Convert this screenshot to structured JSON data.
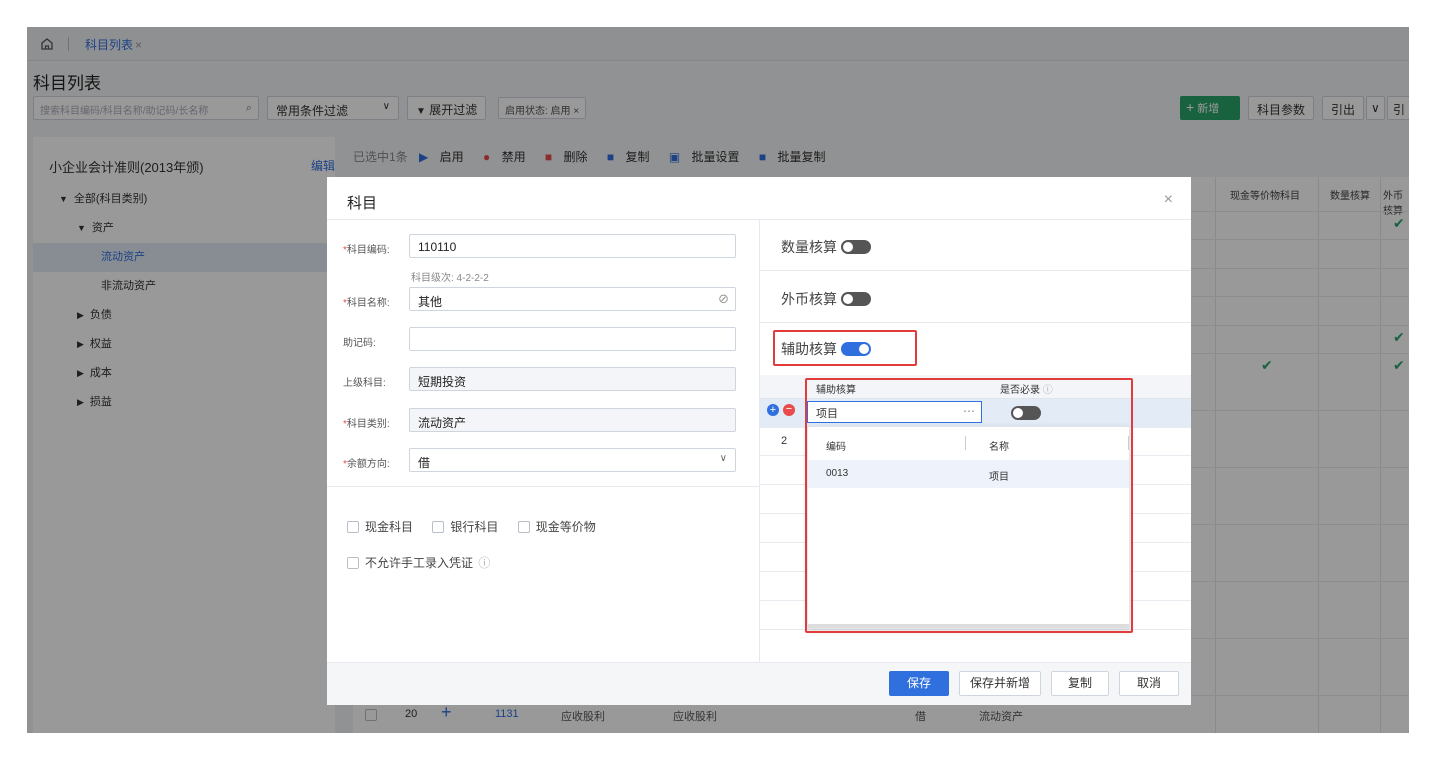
{
  "tabbar": {
    "home_icon": "home-icon",
    "tab_label": "科目列表",
    "tab_close": "×"
  },
  "page": {
    "title": "科目列表"
  },
  "toolbar": {
    "search_placeholder": "搜索科目编码/科目名称/助记码/长名称",
    "filter_select": "常用条件过滤",
    "expand_filter": "展开过滤",
    "status_tag": "启用状态: 启用 ×",
    "add": "新增",
    "params": "科目参数",
    "export": "引出",
    "export_more": "引"
  },
  "left_panel": {
    "title": "小企业会计准则(2013年颁)",
    "edit": "编辑",
    "tree": [
      {
        "label": "全部(科目类别)",
        "arrow": "▼",
        "indent": 0
      },
      {
        "label": "资产",
        "arrow": "▼",
        "indent": 1
      },
      {
        "label": "流动资产",
        "arrow": "",
        "indent": 2,
        "active": true
      },
      {
        "label": "非流动资产",
        "arrow": "",
        "indent": 2
      },
      {
        "label": "负债",
        "arrow": "▶",
        "indent": 1
      },
      {
        "label": "权益",
        "arrow": "▶",
        "indent": 1
      },
      {
        "label": "成本",
        "arrow": "▶",
        "indent": 1
      },
      {
        "label": "损益",
        "arrow": "▶",
        "indent": 1
      }
    ]
  },
  "action_bar": {
    "selected": "已选中1条",
    "enable": "启用",
    "disable": "禁用",
    "delete": "删除",
    "copy": "复制",
    "batch_set": "批量设置",
    "batch_copy": "批量复制"
  },
  "grid": {
    "headers": [
      "现金等价物科目",
      "数量核算",
      "外币核算"
    ],
    "bottom_row": {
      "index": "20",
      "add": "+",
      "code": "1131",
      "name": "应收股利",
      "full_name": "应收股利",
      "direction": "借",
      "category": "流动资产"
    }
  },
  "modal": {
    "title": "科目",
    "close": "×",
    "fields": {
      "code_label": "科目编码:",
      "code_value": "110110",
      "level_hint": "科目级次: 4-2-2-2",
      "name_label": "科目名称:",
      "name_value": "其他",
      "mnemonic_label": "助记码:",
      "mnemonic_value": "",
      "parent_label": "上级科目:",
      "parent_value": "短期投资",
      "category_label": "科目类别:",
      "category_value": "流动资产",
      "direction_label": "余额方向:",
      "direction_value": "借"
    },
    "checkboxes": {
      "cash": "现金科目",
      "bank": "银行科目",
      "cash_equiv": "现金等价物",
      "no_manual": "不允许手工录入凭证"
    },
    "right": {
      "qty_label": "数量核算",
      "currency_label": "外币核算",
      "aux_label": "辅助核算",
      "aux_table": {
        "col1": "辅助核算",
        "col2": "是否必录",
        "row1_value": "项目",
        "row2_index": "2"
      },
      "dropdown": {
        "col_code": "编码",
        "col_name": "名称",
        "code": "0013",
        "name": "项目"
      }
    },
    "footer": {
      "save": "保存",
      "save_new": "保存并新增",
      "copy": "复制",
      "cancel": "取消"
    }
  },
  "colors": {
    "primary": "#2f6fde",
    "green": "#2ba36b",
    "highlight": "#e23b3b"
  }
}
